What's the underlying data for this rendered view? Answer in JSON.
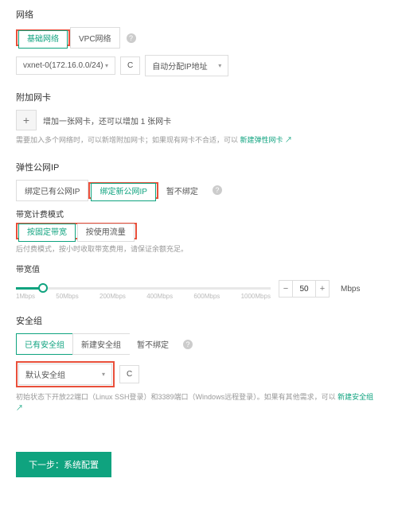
{
  "network": {
    "title": "网络",
    "tabs": {
      "basic": "基础网络",
      "vpc": "VPC网络"
    },
    "subnet_selected": "vxnet-0(172.16.0.0/24)",
    "refresh_icon": "C",
    "ip_mode": "自动分配IP地址"
  },
  "nic": {
    "title": "附加网卡",
    "add_icon": "+",
    "add_text": "增加一张网卡，还可以增加 1 张网卡",
    "note_prefix": "需要加入多个网络时，可以新增附加网卡；如果现有网卡不合适，可以 ",
    "note_link": "新建弹性网卡"
  },
  "eip": {
    "title": "弹性公网IP",
    "tabs": {
      "existing": "绑定已有公网IP",
      "new": "绑定新公网IP",
      "none": "暂不绑定"
    },
    "billing_label": "带宽计费模式",
    "billing_tabs": {
      "fixed": "按固定带宽",
      "traffic": "按使用流量"
    },
    "billing_note": "后付费模式，按小时收取带宽费用，请保证余额充足。",
    "bandwidth_label": "带宽值",
    "ticks": [
      "1Mbps",
      "50Mbps",
      "200Mbps",
      "400Mbps",
      "600Mbps",
      "1000Mbps"
    ],
    "stepper": {
      "minus": "−",
      "value": "50",
      "plus": "+"
    },
    "unit": "Mbps"
  },
  "sg": {
    "title": "安全组",
    "tabs": {
      "existing": "已有安全组",
      "new": "新建安全组",
      "none": "暂不绑定"
    },
    "selected": "默认安全组",
    "refresh_icon": "C",
    "note_prefix": "初始状态下开放22端口（Linux SSH登录）和3389端口（Windows远程登录）。如果有其他需求，可以 ",
    "note_link": "新建安全组"
  },
  "next_button": "下一步：系统配置",
  "help_icon": "?",
  "external_icon": "↗"
}
